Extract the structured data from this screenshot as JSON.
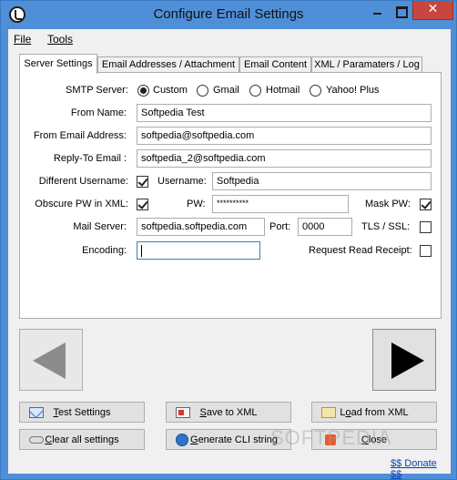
{
  "window": {
    "title": "Configure Email Settings",
    "close_glyph": "✕",
    "accent": "#4f8fd8",
    "close_color": "#c7463d"
  },
  "menu": {
    "file": "File",
    "tools": "Tools"
  },
  "tabs": [
    {
      "label": "Server Settings",
      "active": true
    },
    {
      "label": "Email Addresses / Attachment"
    },
    {
      "label": "Email Content"
    },
    {
      "label": "XML / Paramaters / Log"
    }
  ],
  "form": {
    "smtp_server_label": "SMTP Server:",
    "smtp_options": [
      "Custom",
      "Gmail",
      "Hotmail",
      "Yahoo! Plus"
    ],
    "smtp_selected": "Custom",
    "from_name_label": "From Name:",
    "from_name_value": "Softpedia Test",
    "from_email_label": "From Email Address:",
    "from_email_value": "softpedia@softpedia.com",
    "reply_to_label": "Reply-To Email :",
    "reply_to_value": "softpedia_2@softpedia.com",
    "diff_username_label": "Different Username:",
    "diff_username_checked": true,
    "username_label": "Username:",
    "username_value": "Softpedia",
    "obscure_pw_label": "Obscure PW in XML:",
    "obscure_pw_checked": true,
    "pw_label": "PW:",
    "pw_value": "**********",
    "mask_pw_label": "Mask PW:",
    "mask_pw_checked": true,
    "mail_server_label": "Mail Server:",
    "mail_server_value": "softpedia.softpedia.com",
    "port_label": "Port:",
    "port_value": "0000",
    "tls_label": "TLS / SSL:",
    "tls_checked": false,
    "encoding_label": "Encoding:",
    "encoding_value": "",
    "read_receipt_label": "Request Read Receipt:",
    "read_receipt_checked": false
  },
  "nav": {
    "prev_icon": "arrow-left-icon",
    "next_icon": "arrow-right-icon"
  },
  "buttons": {
    "test_settings": {
      "mnemonic": "T",
      "rest": "est Settings",
      "icon": "mail-icon"
    },
    "save_to_xml": {
      "mnemonic": "S",
      "rest": "ave to XML",
      "icon": "save-icon"
    },
    "load_from_xml": {
      "pre": "L",
      "mnemonic": "o",
      "rest": "ad from XML",
      "icon": "folder-icon"
    },
    "clear_all": {
      "mnemonic": "C",
      "rest": "lear all settings",
      "icon": "eraser-icon"
    },
    "generate_cli": {
      "mnemonic": "G",
      "rest": "enerate CLI string",
      "icon": "globe-icon"
    },
    "close": {
      "mnemonic": "C",
      "rest": "lose",
      "icon": "close-icon"
    }
  },
  "donate_link": "$$ Donate $$",
  "watermark": "SOFTPEDIA"
}
